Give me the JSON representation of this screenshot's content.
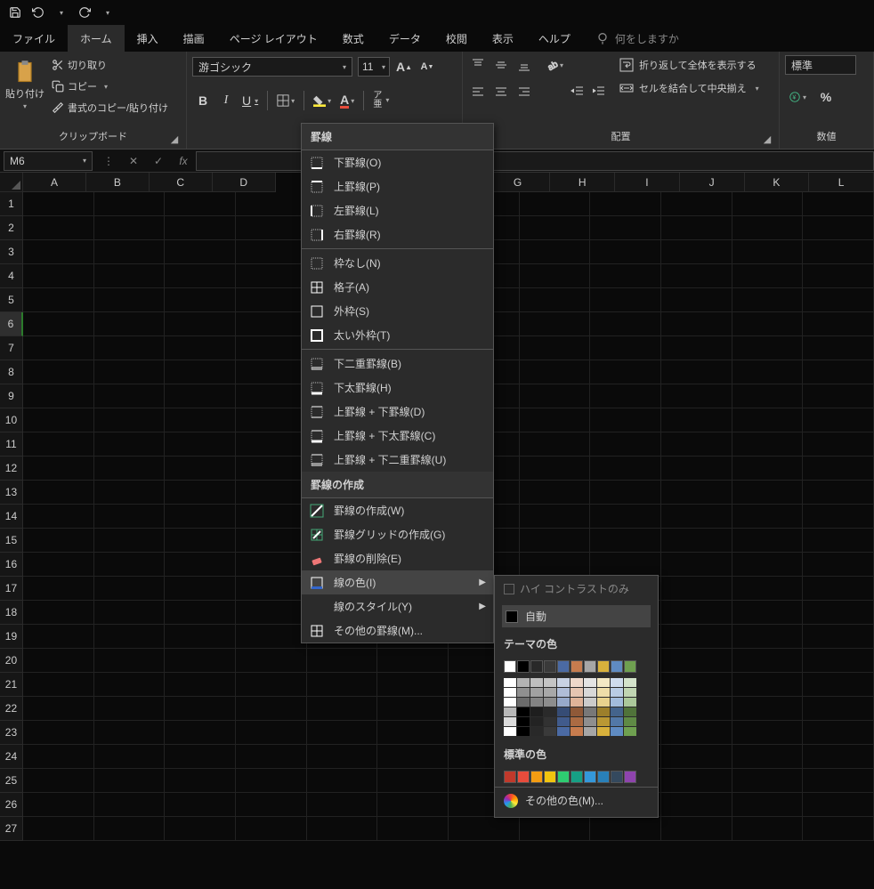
{
  "tabs": {
    "file": "ファイル",
    "home": "ホーム",
    "insert": "挿入",
    "draw": "描画",
    "layout": "ページ レイアウト",
    "formulas": "数式",
    "data": "データ",
    "review": "校閲",
    "view": "表示",
    "help": "ヘルプ"
  },
  "tellme": "何をしますか",
  "clipboard": {
    "paste": "貼り付け",
    "cut": "切り取り",
    "copy": "コピー",
    "painter": "書式のコピー/貼り付け",
    "group": "クリップボード"
  },
  "font": {
    "name": "游ゴシック",
    "size": "11"
  },
  "align_group": "配置",
  "wrap": "折り返して全体を表示する",
  "merge": "セルを結合して中央揃え",
  "num_group": "数値",
  "num_format": "標準",
  "namebox": "M6",
  "cols": [
    "A",
    "B",
    "C",
    "D",
    "G",
    "H",
    "I",
    "J",
    "K",
    "L"
  ],
  "rowcount": 27,
  "bmenu": {
    "header1": "罫線",
    "bottom": "下罫線(O)",
    "top": "上罫線(P)",
    "left": "左罫線(L)",
    "right": "右罫線(R)",
    "none": "枠なし(N)",
    "all": "格子(A)",
    "outside": "外枠(S)",
    "thick": "太い外枠(T)",
    "dbl_bottom": "下二重罫線(B)",
    "thick_bottom": "下太罫線(H)",
    "top_bottom": "上罫線 + 下罫線(D)",
    "top_thickbtm": "上罫線 + 下太罫線(C)",
    "top_dblbtm": "上罫線 + 下二重罫線(U)",
    "header2": "罫線の作成",
    "draw": "罫線の作成(W)",
    "drawgrid": "罫線グリッドの作成(G)",
    "erase": "罫線の削除(E)",
    "linecolor": "線の色(I)",
    "linestyle": "線のスタイル(Y)",
    "more": "その他の罫線(M)..."
  },
  "cmenu": {
    "hc": "ハイ コントラストのみ",
    "auto": "自動",
    "theme": "テーマの色",
    "themecolors": [
      "#ffffff",
      "#000000",
      "#292929",
      "#3a3a3a",
      "#4b6aa3",
      "#c77c4e",
      "#a6a6a6",
      "#d8b13c",
      "#5f8bc2",
      "#6fa050"
    ],
    "std_header": "標準の色",
    "std": [
      "#c0392b",
      "#e74c3c",
      "#f39c12",
      "#f1c40f",
      "#2ecc71",
      "#16a085",
      "#3498db",
      "#2980b9",
      "#34495e",
      "#8e44ad"
    ],
    "more": "その他の色(M)..."
  }
}
